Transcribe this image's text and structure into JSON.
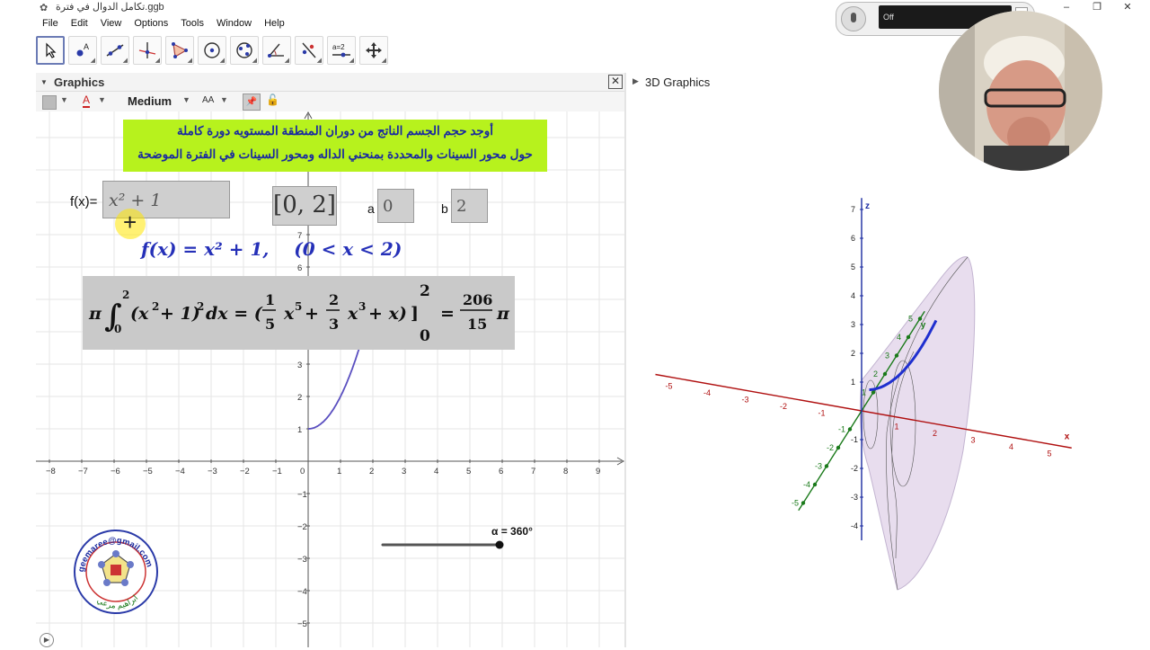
{
  "window": {
    "title": "تكامل الدوال في فترة.ggb",
    "controls": [
      "‒",
      "❐",
      "✕"
    ]
  },
  "menu": [
    "File",
    "Edit",
    "View",
    "Options",
    "Tools",
    "Window",
    "Help"
  ],
  "toolbar": {
    "tools": [
      {
        "name": "move-tool",
        "icon": "arrow-cursor-icon"
      },
      {
        "name": "point-tool",
        "icon": "point-icon"
      },
      {
        "name": "line-tool",
        "icon": "line-icon"
      },
      {
        "name": "perpendicular-tool",
        "icon": "perpendicular-icon"
      },
      {
        "name": "polygon-tool",
        "icon": "polygon-icon"
      },
      {
        "name": "circle-tool",
        "icon": "circle-icon"
      },
      {
        "name": "ellipse-tool",
        "icon": "ellipse-icon"
      },
      {
        "name": "angle-tool",
        "icon": "angle-icon"
      },
      {
        "name": "reflect-tool",
        "icon": "reflect-icon"
      },
      {
        "name": "slider-tool",
        "icon": "slider-icon",
        "label": "a=2"
      },
      {
        "name": "move-view-tool",
        "icon": "move-view-icon"
      }
    ]
  },
  "graphics_panel": {
    "title": "Graphics",
    "style_bar": {
      "line_style": "Medium",
      "text_size_label": "AA",
      "color_label": "A"
    }
  },
  "view3d": {
    "title": "3D Graphics"
  },
  "banner": {
    "line1": "أوجد حجم الجسم الناتج من دوران المنطقة المستويه دورة كاملة",
    "line2": "حول محور السينات والمحددة بمنحني الداله ومحور السينات في الفترة الموضحة"
  },
  "inputs": {
    "fx_label": "f(x)=",
    "fx_value": "x² + 1",
    "interval": "[0, 2]",
    "a_label": "a",
    "a_value": "0",
    "b_label": "b",
    "b_value": "2"
  },
  "formula": {
    "function_text": "f(x) = x² + 1,    (0 < x < 2)"
  },
  "slider": {
    "label": "α = 360°",
    "fraction": 1.0
  },
  "logo": {
    "email": "geemaree@gmail.com",
    "name": "ابراهيم مرعي"
  },
  "camera": {
    "status": "Off"
  },
  "axes2d": {
    "x_ticks": [
      "−8",
      "−7",
      "−6",
      "−5",
      "−4",
      "−3",
      "−2",
      "−1",
      "0",
      "1",
      "2",
      "3",
      "4",
      "5",
      "6",
      "7",
      "8",
      "9"
    ],
    "y_ticks": [
      "7",
      "6",
      "3",
      "2",
      "1",
      "−1",
      "−2",
      "−3",
      "−4",
      "−5"
    ]
  },
  "axes3d": {
    "x_label": "x",
    "y_label": "y",
    "z_label": "z",
    "x_ticks": [
      "-5",
      "-4",
      "-3",
      "-2",
      "-1",
      "1",
      "2",
      "3",
      "4",
      "5"
    ],
    "y_ticks": [
      "-5",
      "-4",
      "-3",
      "-2",
      "-1",
      "1",
      "2",
      "3",
      "4",
      "5"
    ],
    "z_ticks": [
      "7",
      "6",
      "5",
      "4",
      "3",
      "2",
      "1",
      "-1",
      "-2",
      "-3",
      "-4"
    ]
  },
  "colors": {
    "banner_bg": "#b7f21d",
    "banner_text": "#1a2aa0",
    "curve": "#5a4fc0",
    "formula_text": "#2530b8",
    "x_axis_3d": "#b01010",
    "y_axis_3d": "#1a7a1a",
    "z_axis_3d": "#1a2aa0"
  }
}
